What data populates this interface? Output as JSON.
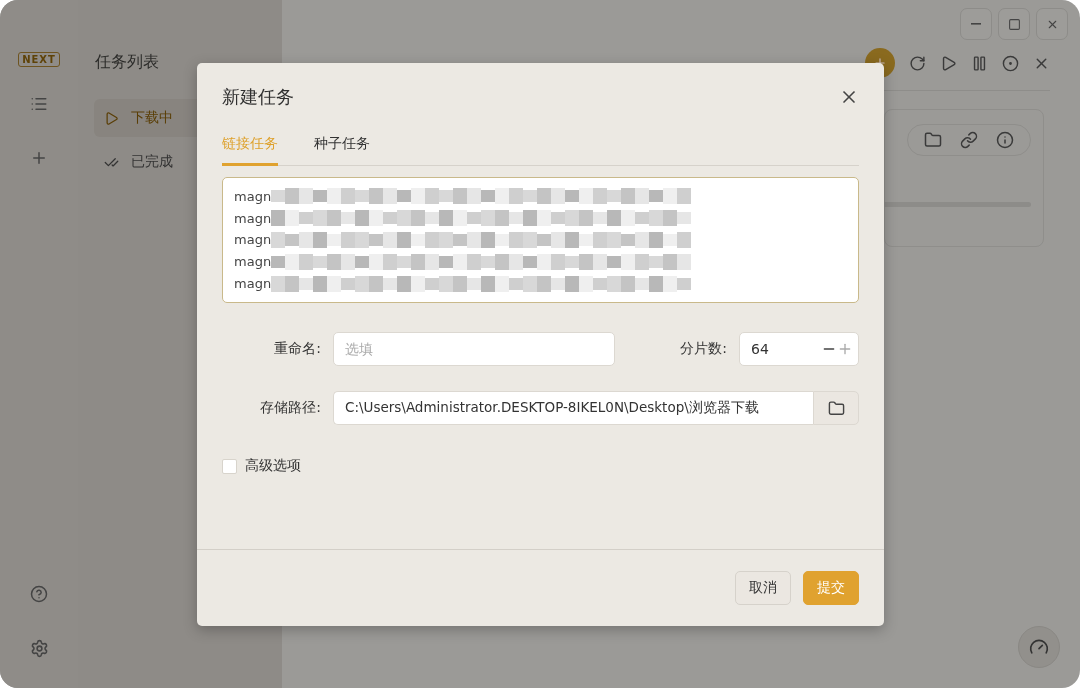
{
  "sidebar": {
    "logo": "NEXT"
  },
  "task_list": {
    "title": "任务列表",
    "items": [
      {
        "label": "下载中",
        "selected": true,
        "kind": "downloading"
      },
      {
        "label": "已完成",
        "selected": false,
        "kind": "done"
      }
    ]
  },
  "dialog": {
    "title": "新建任务",
    "tabs": [
      {
        "label": "链接任务",
        "selected": true
      },
      {
        "label": "种子任务",
        "selected": false
      }
    ],
    "links": [
      "magn",
      "magn",
      "magn",
      "magn",
      "magn"
    ],
    "rename": {
      "label": "重命名:",
      "placeholder": "选填"
    },
    "segments": {
      "label": "分片数:",
      "value": "64"
    },
    "path": {
      "label": "存储路径:",
      "value": "C:\\Users\\Administrator.DESKTOP-8IKEL0N\\Desktop\\浏览器下载"
    },
    "advanced": {
      "label": "高级选项",
      "checked": false
    },
    "buttons": [
      {
        "label": "取消",
        "kind": "secondary"
      },
      {
        "label": "提交",
        "kind": "primary"
      }
    ]
  }
}
